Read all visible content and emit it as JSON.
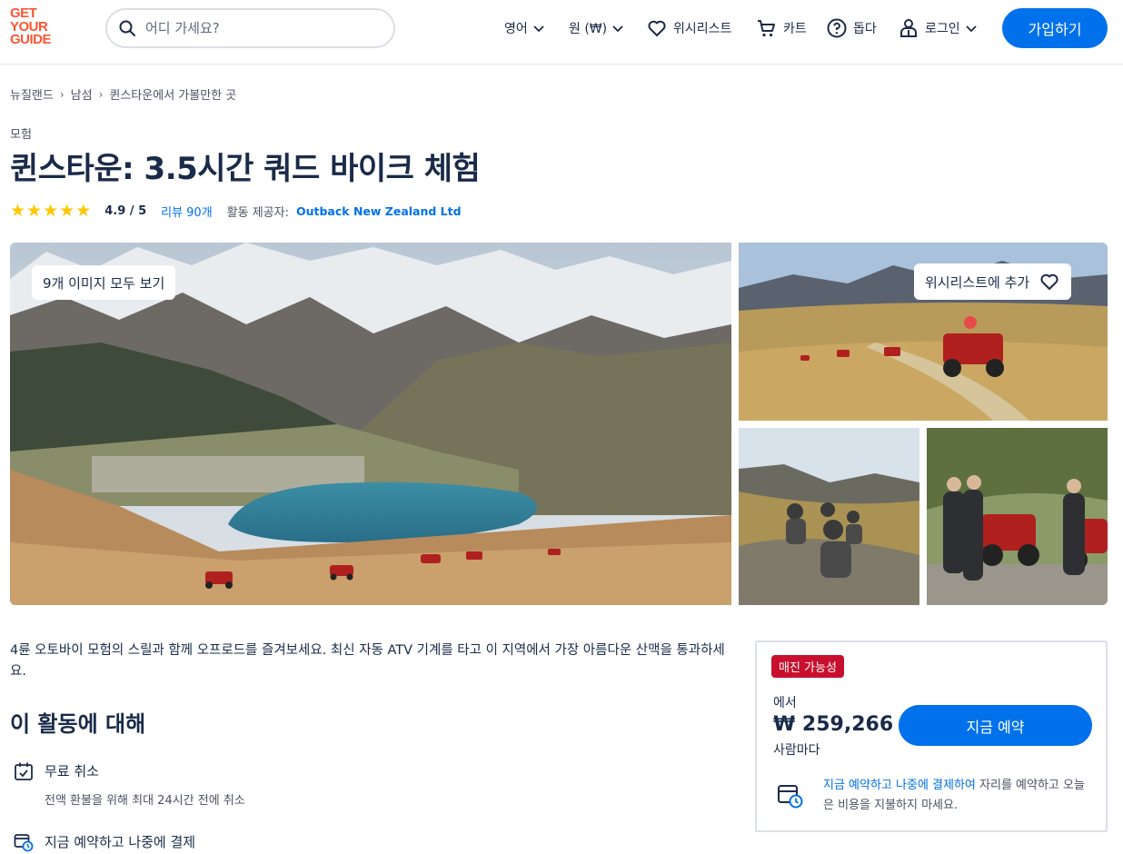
{
  "header": {
    "logo_lines": [
      "GET",
      "YOUR",
      "GUIDE"
    ],
    "search_placeholder": "어디 가세요?",
    "language": "영어",
    "currency": "원 (₩)",
    "wishlist": "위시리스트",
    "cart": "카트",
    "help": "돕다",
    "login": "로그인",
    "signup": "가입하기"
  },
  "breadcrumb": [
    "뉴질랜드",
    "남섬",
    "퀸스타운에서 가볼만한 곳"
  ],
  "activity": {
    "category": "모험",
    "title": "퀸스타운: 3.5시간 쿼드 바이크 체험",
    "rating": "4.9 / 5",
    "stars": 5,
    "reviews": "리뷰 90개",
    "provider_label": "활동 제공자:",
    "provider": "Outback New Zealand Ltd"
  },
  "gallery": {
    "view_all": "9개 이미지 모두 보기",
    "wishlist_add": "위시리스트에 추가"
  },
  "description": "4륜 오토바이 모험의 스릴과 함께 오프로드를 즐겨보세요. 최신 자동 ATV 기계를 타고 이 지역에서 가장 아름다운 산맥을 통과하세요.",
  "about": {
    "title": "이 활동에 대해",
    "features": [
      {
        "name": "무료 취소",
        "sub": "전액 환불을 위해 최대 24시간 전에 취소"
      },
      {
        "name": "지금 예약하고 나중에 결제",
        "sub": ""
      }
    ]
  },
  "booking": {
    "badge": "매진 가능성",
    "from": "에서",
    "price": "₩ 259,266",
    "per": "사람마다",
    "book_button": "지금 예약",
    "rnpl_link": "지금 예약하고 나중에 결제하여",
    "rnpl_text": " 자리를 예약하고 오늘은 비용을 지불하지 마세요."
  },
  "colors": {
    "brand": "#ff5533",
    "primary": "#0071eb",
    "text": "#1a2b49",
    "star": "#ffc700",
    "badge": "#c8102e"
  }
}
